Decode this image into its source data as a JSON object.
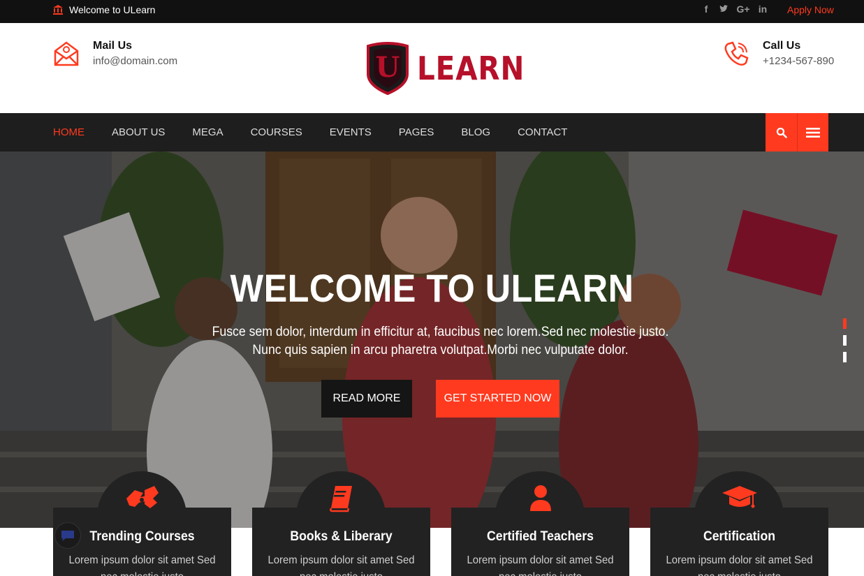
{
  "topbar": {
    "welcome": "Welcome to ULearn",
    "socials": [
      "f",
      "t",
      "G+",
      "in"
    ],
    "apply": "Apply Now"
  },
  "header": {
    "mail": {
      "title": "Mail Us",
      "value": "info@domain.com",
      "icon": "mail-icon"
    },
    "logo": {
      "letter": "U",
      "text": "LEARN"
    },
    "call": {
      "title": "Call Us",
      "value": "+1234-567-890",
      "icon": "phone-icon"
    }
  },
  "nav": {
    "items": [
      "HOME",
      "ABOUT US",
      "MEGA",
      "COURSES",
      "EVENTS",
      "PAGES",
      "BLOG",
      "CONTACT"
    ],
    "active": "HOME"
  },
  "hero": {
    "title": "WELCOME TO ULEARN",
    "subtitle_line1": "Fusce sem dolor, interdum in efficitur at, faucibus nec lorem.Sed nec molestie justo.",
    "subtitle_line2": "Nunc quis sapien in arcu pharetra volutpat.Morbi nec vulputate dolor.",
    "read_more": "READ MORE",
    "get_started": "GET STARTED NOW",
    "slides": 3,
    "active_slide": 1
  },
  "features": [
    {
      "title": "Trending Courses",
      "text": "Lorem ipsum dolor sit amet Sed nec molestie justo",
      "icon": "sign-language-icon"
    },
    {
      "title": "Books & Liberary",
      "text": "Lorem ipsum dolor sit amet Sed nec molestie justo",
      "icon": "book-icon"
    },
    {
      "title": "Certified Teachers",
      "text": "Lorem ipsum dolor sit amet Sed nec molestie justo",
      "icon": "user-icon"
    },
    {
      "title": "Certification",
      "text": "Lorem ipsum dolor sit amet Sed nec molestie justo",
      "icon": "graduation-cap-icon"
    }
  ],
  "colors": {
    "accent": "#ff3a1f",
    "dark": "#1e1e1e",
    "logo": "#b6102a"
  }
}
